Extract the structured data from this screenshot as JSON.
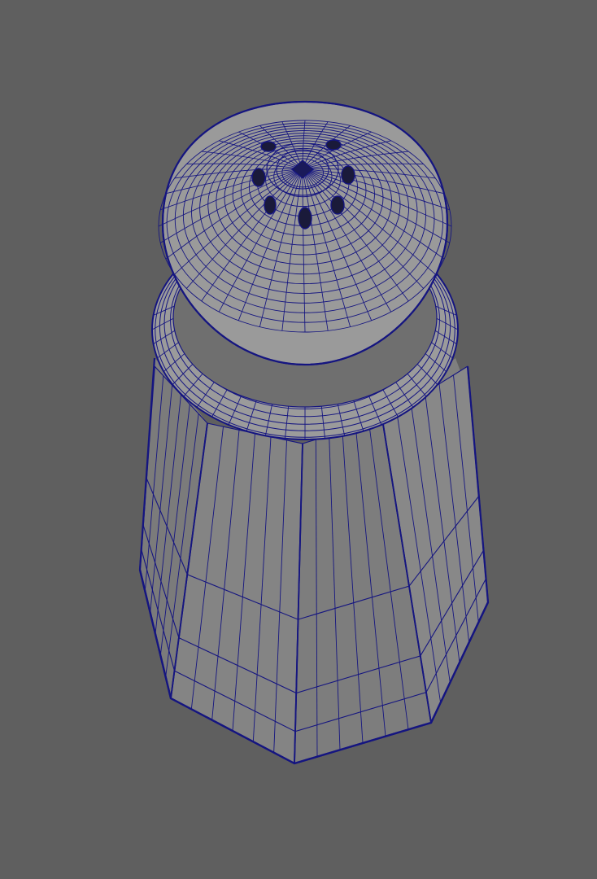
{
  "viewport": {
    "background_color": "#5f5f5f",
    "mesh": {
      "object": "salt-shaker",
      "display_mode": "wireframe-on-shaded",
      "shaded_color": "#9a9a9a",
      "shaded_dark_color": "#7f7f7f",
      "wire_color": "#151580",
      "glass_side_count": 8
    }
  }
}
